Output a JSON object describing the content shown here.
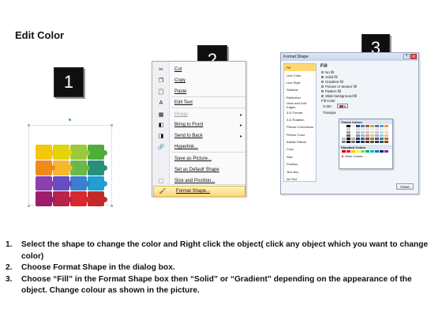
{
  "title": "Edit Color",
  "badges": [
    "1",
    "2",
    "3"
  ],
  "puzzle": {
    "colors": [
      [
        "#f2c80f",
        "#e1d40a",
        "#9bc93a",
        "#4fae3a"
      ],
      [
        "#f08a1a",
        "#f7b72c",
        "#6bb84a",
        "#2a8f7a"
      ],
      [
        "#8b3fb0",
        "#6a4cc3",
        "#3a7fd0",
        "#1f9fd4"
      ],
      [
        "#9c1e6c",
        "#b8234a",
        "#d8282a",
        "#c32a2a"
      ]
    ]
  },
  "context_menu": {
    "items": [
      {
        "icon": "scissors-icon",
        "glyph": "✂",
        "label": "Cut",
        "disabled": false,
        "submenu": false
      },
      {
        "icon": "copy-icon",
        "glyph": "❐",
        "label": "Copy",
        "disabled": false,
        "submenu": false
      },
      {
        "icon": "paste-icon",
        "glyph": "📋",
        "label": "Paste",
        "disabled": false,
        "submenu": false
      },
      {
        "icon": "edit-text-icon",
        "glyph": "A",
        "label": "Edit Text",
        "disabled": false,
        "submenu": false
      },
      {
        "icon": "group-icon",
        "glyph": "▦",
        "label": "Group",
        "disabled": true,
        "submenu": true
      },
      {
        "icon": "bring-to-front-icon",
        "glyph": "◧",
        "label": "Bring to Front",
        "disabled": false,
        "submenu": true
      },
      {
        "icon": "send-to-back-icon",
        "glyph": "◨",
        "label": "Send to Back",
        "disabled": false,
        "submenu": true
      },
      {
        "icon": "hyperlink-icon",
        "glyph": "🔗",
        "label": "Hyperlink...",
        "disabled": false,
        "submenu": false
      },
      {
        "icon": "save-as-picture-icon",
        "glyph": "",
        "label": "Save as Picture...",
        "disabled": false,
        "submenu": false
      },
      {
        "icon": "default-shape-icon",
        "glyph": "",
        "label": "Set as Default Shape",
        "disabled": false,
        "submenu": false
      },
      {
        "icon": "size-position-icon",
        "glyph": "⬚",
        "label": "Size and Position...",
        "disabled": false,
        "submenu": false
      },
      {
        "icon": "format-shape-icon",
        "glyph": "🖌",
        "label": "Format Shape...",
        "disabled": false,
        "submenu": false,
        "active": true
      }
    ]
  },
  "format_dialog": {
    "title": "Format Shape",
    "nav": [
      "Fill",
      "Line Color",
      "Line Style",
      "Shadow",
      "Reflection",
      "Glow and Soft Edges",
      "3-D Format",
      "3-D Rotation",
      "Picture Corrections",
      "Picture Color",
      "Artistic Effects",
      "Crop",
      "Size",
      "Position",
      "Text Box",
      "Alt Text"
    ],
    "selected_nav": "Fill",
    "pane_title": "Fill",
    "options": [
      {
        "label": "No fill",
        "selected": false
      },
      {
        "label": "Solid fill",
        "selected": true
      },
      {
        "label": "Gradient fill",
        "selected": false
      },
      {
        "label": "Picture or texture fill",
        "selected": false
      },
      {
        "label": "Pattern fill",
        "selected": false
      },
      {
        "label": "Slide background fill",
        "selected": false
      }
    ],
    "fill_color_label": "Fill Color",
    "color_label": "Color:",
    "transparency_label": "Transpa",
    "palette_theme_label": "Theme Colors",
    "palette_standard_label": "Standard Colors",
    "more_colors_label": "More Colors...",
    "close_label": "Close",
    "theme_colors": [
      "#ffffff",
      "#000000",
      "#eeece1",
      "#1f497d",
      "#4f81bd",
      "#c0504d",
      "#9bbb59",
      "#8064a2",
      "#4bacc6",
      "#f79646"
    ],
    "standard_colors": [
      "#c00000",
      "#ff0000",
      "#ffc000",
      "#ffff00",
      "#92d050",
      "#00b050",
      "#00b0f0",
      "#0070c0",
      "#002060",
      "#7030a0"
    ]
  },
  "steps": [
    {
      "num": "1.",
      "text": "Select the shape to change the color and Right click the object( click any object which you want to change color)"
    },
    {
      "num": "2.",
      "text": "Choose Format Shape in the dialog box."
    },
    {
      "num": "3.",
      "text": "Choose “Fill” in the Format Shape box then “Solid” or “Gradient” depending on the appearance of the object. Change colour as shown in the picture."
    }
  ]
}
